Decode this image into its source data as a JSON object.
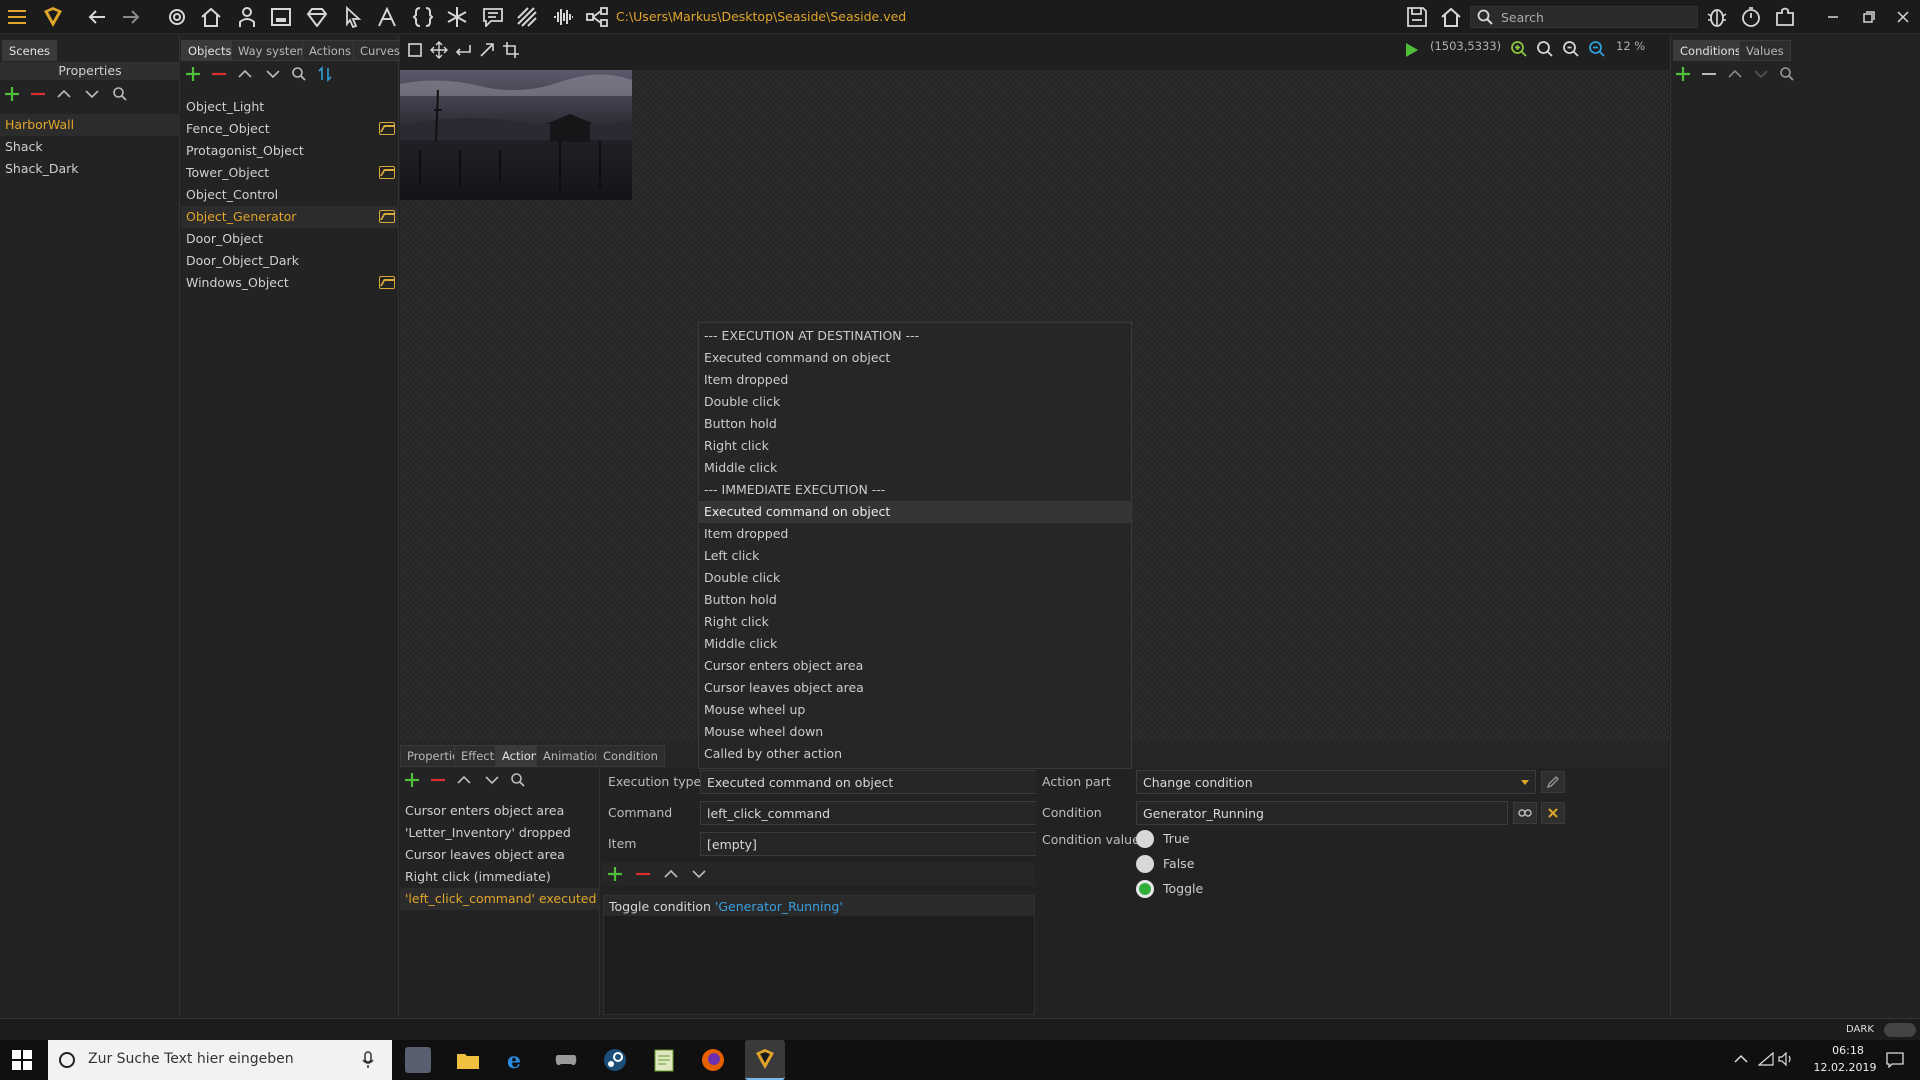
{
  "window": {
    "path": "C:\\Users\\Markus\\Desktop\\Seaside\\Seaside.ved",
    "search_placeholder": "Search",
    "coords": "(1503,5333)",
    "zoom": "12 %"
  },
  "left_panel": {
    "tab_scenes": "Scenes",
    "header_properties": "Properties",
    "scenes": [
      "HarborWall",
      "Shack",
      "Shack_Dark"
    ],
    "selected_index": 0
  },
  "objects_panel": {
    "tabs": [
      "Objects",
      "Way system",
      "Actions",
      "Curves"
    ],
    "active_tab": 0,
    "items": [
      {
        "label": "Object_Light",
        "flag": false
      },
      {
        "label": "Fence_Object",
        "flag": true
      },
      {
        "label": "Protagonist_Object",
        "flag": false
      },
      {
        "label": "Tower_Object",
        "flag": true
      },
      {
        "label": "Object_Control",
        "flag": false
      },
      {
        "label": "Object_Generator",
        "flag": true
      },
      {
        "label": "Door_Object",
        "flag": false
      },
      {
        "label": "Door_Object_Dark",
        "flag": false
      },
      {
        "label": "Windows_Object",
        "flag": true
      }
    ],
    "selected_index": 5
  },
  "right_panel": {
    "tabs": [
      "Conditions",
      "Values"
    ]
  },
  "dropdown": {
    "items": [
      "--- EXECUTION AT DESTINATION ---",
      "Executed command on object",
      "Item dropped",
      "Double click",
      "Button hold",
      "Right click",
      "Middle click",
      "--- IMMEDIATE EXECUTION ---",
      "Executed command on object",
      "Item dropped",
      "Left click",
      "Double click",
      "Button hold",
      "Right click",
      "Middle click",
      "Cursor enters object area",
      "Cursor leaves object area",
      "Mouse wheel up",
      "Mouse wheel down",
      "Called by other action"
    ],
    "highlighted_index": 8
  },
  "bottom": {
    "tabs": [
      "Properties",
      "Effects",
      "Actions",
      "Animations",
      "Condition"
    ],
    "active_tab": 2,
    "actions": [
      "Cursor enters object area",
      "'Letter_Inventory' dropped",
      "Cursor leaves object area",
      "Right click (immediate)",
      "'left_click_command' executed (im"
    ],
    "selected_action": 4,
    "execution_type_label": "Execution type",
    "execution_type_value": "Executed command on object",
    "command_label": "Command",
    "command_value": "left_click_command",
    "item_label": "Item",
    "item_value": "[empty]",
    "action_part_prefix": "Toggle condition ",
    "action_part_link": "'Generator_Running'",
    "action_part_label": "Action part",
    "action_part_value": "Change condition",
    "condition_label": "Condition",
    "condition_value": "Generator_Running",
    "condition_value_label": "Condition value",
    "radio_options": [
      "True",
      "False",
      "Toggle"
    ],
    "radio_selected": 2
  },
  "status": {
    "theme_badge": "DARK"
  },
  "taskbar": {
    "search_placeholder": "Zur Suche Text hier eingeben",
    "time": "06:18",
    "date": "12.02.2019"
  }
}
